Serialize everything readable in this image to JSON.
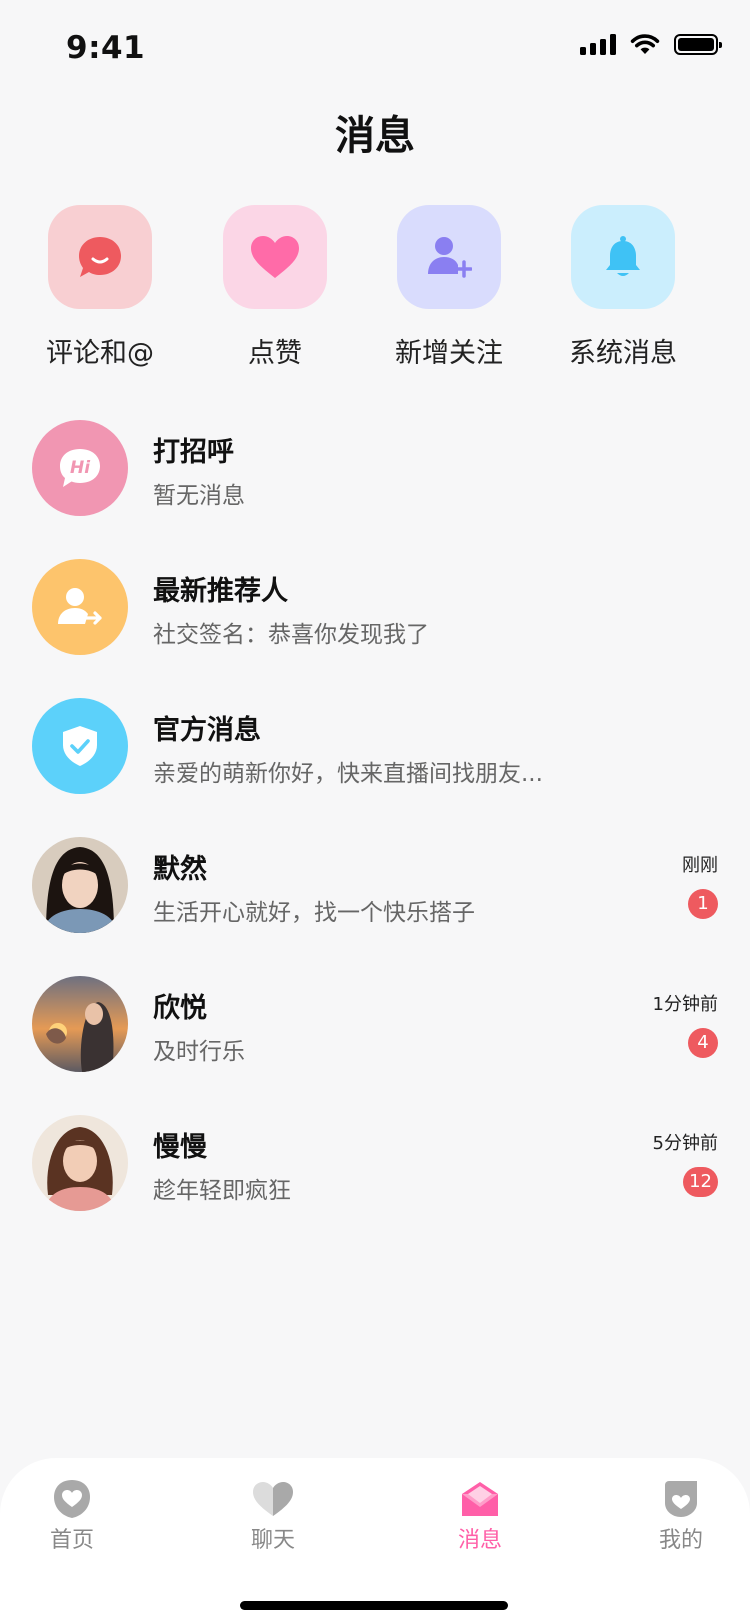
{
  "status": {
    "time": "9:41"
  },
  "title": "消息",
  "quick": [
    {
      "label": "评论和@",
      "icon": "comment-smile-icon",
      "bg": "#f8cfd2",
      "color": "#ee5a5f"
    },
    {
      "label": "点赞",
      "icon": "heart-icon",
      "bg": "#fbd6e6",
      "color": "#ff6ba8"
    },
    {
      "label": "新增关注",
      "icon": "add-user-icon",
      "bg": "#d9dcfd",
      "color": "#8a7ff1"
    },
    {
      "label": "系统消息",
      "icon": "bell-icon",
      "bg": "#cbeefd",
      "color": "#3fc2f5"
    }
  ],
  "list": [
    {
      "name": "打招呼",
      "preview": "暂无消息",
      "icon": "hi-bubble-icon",
      "bg": "#f196b2"
    },
    {
      "name": "最新推荐人",
      "preview": "社交签名：恭喜你发现我了",
      "icon": "user-share-icon",
      "bg": "#fdc46c"
    },
    {
      "name": "官方消息",
      "preview": "亲爱的萌新你好，快来直播间找朋友...",
      "icon": "shield-check-icon",
      "bg": "#5cd1fa"
    },
    {
      "name": "默然",
      "preview": "生活开心就好，找一个快乐搭子",
      "time": "刚刚",
      "badge": "1"
    },
    {
      "name": "欣悦",
      "preview": "及时行乐",
      "time": "1分钟前",
      "badge": "4"
    },
    {
      "name": "慢慢",
      "preview": "趁年轻即疯狂",
      "time": "5分钟前",
      "badge": "12"
    }
  ],
  "tabs": [
    {
      "label": "首页",
      "icon": "home-heart-icon",
      "active": false
    },
    {
      "label": "聊天",
      "icon": "chat-heart-icon",
      "active": false
    },
    {
      "label": "消息",
      "icon": "envelope-icon",
      "active": true
    },
    {
      "label": "我的",
      "icon": "profile-heart-icon",
      "active": false
    }
  ],
  "colors": {
    "accent": "#ff5fa8",
    "badge": "#ee5a5f"
  }
}
